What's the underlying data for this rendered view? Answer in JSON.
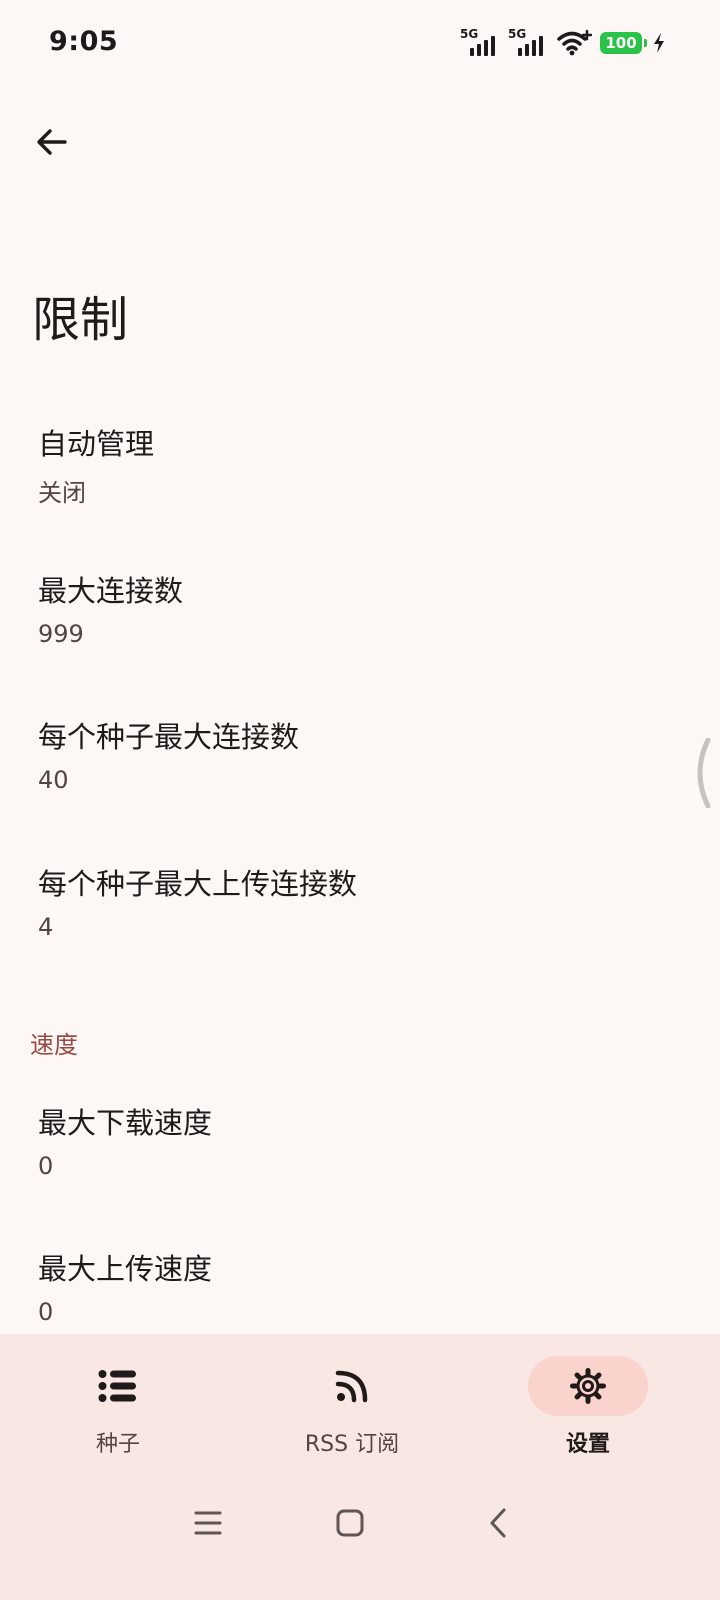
{
  "status_bar": {
    "time": "9:05",
    "signal_1_label": "5G",
    "signal_2_label": "5G",
    "battery_level": "100",
    "charging": true
  },
  "header": {
    "back_icon": "arrow-back-icon",
    "title": "限制"
  },
  "preferences": [
    {
      "title": "自动管理",
      "summary": "关闭"
    },
    {
      "title": "最大连接数",
      "summary": "999"
    },
    {
      "title": "每个种子最大连接数",
      "summary": "40"
    },
    {
      "title": "每个种子最大上传连接数",
      "summary": "4"
    }
  ],
  "speed_section": {
    "header": "速度",
    "items": [
      {
        "title": "最大下载速度",
        "summary": "0"
      },
      {
        "title": "最大上传速度",
        "summary": "0"
      }
    ]
  },
  "bottom_nav": {
    "items": [
      {
        "label": "种子",
        "icon": "list-icon",
        "active": false
      },
      {
        "label": "RSS 订阅",
        "icon": "rss-icon",
        "active": false
      },
      {
        "label": "设置",
        "icon": "gear-icon",
        "active": true
      }
    ]
  },
  "system_nav": {
    "menu_icon": "menu-icon",
    "home_icon": "home-icon",
    "back_icon": "back-chevron-icon"
  },
  "colors": {
    "background": "#fdf7f6",
    "accent": "#9a4a43",
    "nav_background": "#f9e7e4",
    "nav_active_pill": "#fbd3cd",
    "battery": "#2bc24a"
  }
}
